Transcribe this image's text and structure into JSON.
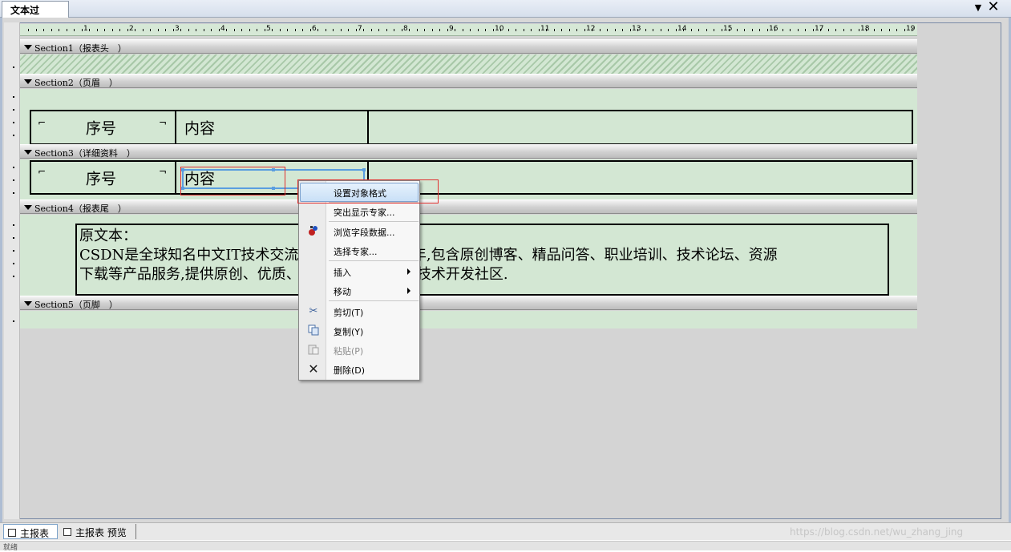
{
  "document": {
    "tab_title": "文本过长.rpt",
    "close_glyph": "✕",
    "menu_glyph": "▼"
  },
  "ruler": {
    "numbers": [
      "1",
      "2",
      "3",
      "4",
      "5",
      "6",
      "7",
      "8",
      "9",
      "10",
      "11",
      "12",
      "13",
      "14",
      "15",
      "16",
      "17",
      "18",
      "19"
    ]
  },
  "sections": [
    {
      "label": "Section1（报表头　）"
    },
    {
      "label": "Section2（页眉　）"
    },
    {
      "label": "Section3（详细资料　）"
    },
    {
      "label": "Section4（报表尾　）"
    },
    {
      "label": "Section5（页脚　）"
    }
  ],
  "fields": {
    "header_seq": "序号",
    "header_content": "内容",
    "detail_seq": "序号",
    "detail_content": "内容"
  },
  "original_text": {
    "line1": "原文本：",
    "line2": "CSDN是全球知名中文IT技术交流平台,创建于1999年,包含原创博客、精品问答、职业培训、技术论坛、资源",
    "line3": "下载等产品服务,提供原创、优质、完整内容的专业IT技术开发社区."
  },
  "context_menu": {
    "items": [
      {
        "label": "设置对象格式",
        "icon": ""
      },
      {
        "label": "突出显示专家...",
        "icon": ""
      },
      {
        "label": "浏览字段数据...",
        "icon": "field-data-icon"
      },
      {
        "label": "选择专家...",
        "icon": ""
      },
      {
        "label": "插入",
        "icon": ""
      },
      {
        "label": "移动",
        "icon": ""
      },
      {
        "label": "剪切(T)",
        "icon": "scissors-icon"
      },
      {
        "label": "复制(Y)",
        "icon": "copy-icon"
      },
      {
        "label": "粘贴(P)",
        "icon": "paste-icon"
      },
      {
        "label": "删除(D)",
        "icon": "delete-x-icon"
      }
    ]
  },
  "bottom_tabs": {
    "main": "主报表",
    "preview": "主报表 预览"
  },
  "watermark": "https://blog.csdn.net/wu_zhang_jing",
  "status": "就绪",
  "colors": {
    "section_body": "#d3e7d3",
    "selection": "#5a9ee0",
    "highlight_box": "#e03030",
    "menu_highlight": "#c9e0f7"
  }
}
